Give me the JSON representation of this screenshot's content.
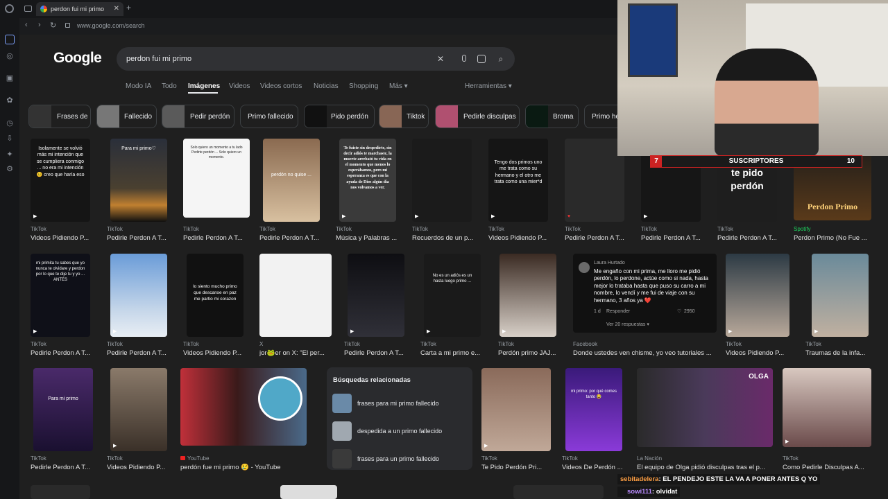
{
  "browser": {
    "tab_title": "perdon fui mi primo",
    "url": "www.google.com/search"
  },
  "google": {
    "logo": "Google",
    "query": "perdon fui mi primo",
    "nav_tabs": [
      "Modo IA",
      "Todo",
      "Imágenes",
      "Videos",
      "Videos cortos",
      "Noticias",
      "Shopping",
      "Más ▾"
    ],
    "tools": "Herramientas ▾"
  },
  "chips": [
    "Frases de",
    "Fallecido",
    "Pedir perdón",
    "Primo fallecido",
    "Pido perdón",
    "Tiktok",
    "Pedirle disculpas",
    "Broma",
    "Primo he"
  ],
  "row1": [
    {
      "src": "TikTok",
      "title": "Videos Pidiendo P...",
      "text": "Isolamente se volvió más mi intención que se cumpliera conmigo ... no era mi intención 😐 creo que haría eso"
    },
    {
      "src": "TikTok",
      "title": "Pedirle Perdon A T...",
      "text": "Para mi primo♡"
    },
    {
      "src": "TikTok",
      "title": "Pedirle Perdon A T...",
      "text": "Solo quiero un momento a tu lado Pedirte perdón ... Solo quiero un momento."
    },
    {
      "src": "TikTok",
      "title": "Pedirle Perdon A T...",
      "text": "perdón no quise ..."
    },
    {
      "src": "TikTok",
      "title": "Música y Palabras ...",
      "text": "Te fuiste sin despedirte, sin decir adiós te marchaste, la muerte arrebató tu vida en el momento que menos lo esperábamos, pero mi esperanza es que con la ayuda de Dios algún día nos volvamos a ver."
    },
    {
      "src": "TikTok",
      "title": "Recuerdos de un p...",
      "text": ""
    },
    {
      "src": "TikTok",
      "title": "Videos Pidiendo P...",
      "text": "Tengo dos primos uno me trata como su hermano y el otro me trata como una mier*d"
    },
    {
      "src": "TikTok",
      "title": "Pedirle Perdon A T...",
      "text": ""
    },
    {
      "src": "TikTok",
      "title": "Pedirle Perdon A T...",
      "text": ""
    },
    {
      "src": "TikTok",
      "title": "Pedirle Perdon A T...",
      "text": "te pido perdón"
    },
    {
      "src": "Spotify",
      "title": "Perdon Primo (No Fue ...",
      "text": "Perdon Primo"
    }
  ],
  "row2": [
    {
      "src": "TikTok",
      "title": "Pedirle Perdon A T...",
      "text": "mi primita tu sabes que yo nunca te olvidare y perdon por lo que te dije tu y yo ... ANTES"
    },
    {
      "src": "TikTok",
      "title": "Pedirle Perdon A T...",
      "text": ""
    },
    {
      "src": "TikTok",
      "title": "Videos Pidiendo P...",
      "text": "lo siento mucho primo que descanse en paz me partio mi corazon"
    },
    {
      "src": "X",
      "title": "jor🐸er on X: \"El per...",
      "text": ""
    },
    {
      "src": "TikTok",
      "title": "Pedirle Perdon A T...",
      "text": ""
    },
    {
      "src": "TikTok",
      "title": "Carta a mi primo e...",
      "text": "No es un adiós es un hasta luego primo ..."
    },
    {
      "src": "TikTok",
      "title": "Perdón primo JAJ...",
      "text": ""
    },
    {
      "src": "Facebook",
      "title": "Donde ustedes ven chisme, yo veo tutoriales ...",
      "text": ""
    },
    {
      "src": "TikTok",
      "title": "Videos Pidiendo P...",
      "text": ""
    },
    {
      "src": "TikTok",
      "title": "Traumas de la infa...",
      "text": ""
    }
  ],
  "facebook_post": {
    "author": "Laura Hurtado",
    "body": "Me engaño con mi prima, me lloro me pidió perdón, lo perdone, actúe como si nada, hasta mejor lo trataba hasta que puso su carro a mi nombre, lo vendí y me fui de viaje con su hermano, 3 años ya ❤️",
    "time": "1 d",
    "reply": "Responder",
    "likes": "2950",
    "more": "Ver 20 respuestas ▾"
  },
  "row3": [
    {
      "src": "TikTok",
      "title": "Pedirle Perdon A T...",
      "text": "Para mi primo"
    },
    {
      "src": "TikTok",
      "title": "Videos Pidiendo P...",
      "text": ""
    },
    {
      "src": "YouTube",
      "title": "perdón fue mi primo 😢 - YouTube",
      "text": ""
    },
    {
      "src": "TikTok",
      "title": "Te Pido Perdón Pri...",
      "text": ""
    },
    {
      "src": "TikTok",
      "title": "Videos De Perdón ...",
      "text": "mi primo: por qué comes tanto 😂"
    },
    {
      "src": "La Nación",
      "title": "El equipo de Olga pidió disculpas tras el p...",
      "text": "OLGA"
    },
    {
      "src": "TikTok",
      "title": "Como Pedirle Disculpas A...",
      "text": ""
    }
  ],
  "related": {
    "heading": "Búsquedas relacionadas",
    "items": [
      "frases para mi primo fallecido",
      "despedida a un primo fallecido",
      "frases para un primo fallecido"
    ]
  },
  "overlay": {
    "subs_count": "7",
    "subs_label": "SUSCRIPTORES",
    "subs_goal": "10",
    "chat": [
      {
        "user": "sebitadelera",
        "msg": ": EL PENDEJO ESTE LA VA A PONER ANTES Q YO"
      },
      {
        "user": "sowi111",
        "msg": ": olvidat"
      }
    ]
  },
  "colors": {
    "bg": "#1f1f1f",
    "chat_user": "#ff9f43",
    "chat_user2": "#b98bff",
    "subs_bar": "#cc2222"
  },
  "icons": [
    "back-icon",
    "forward-icon",
    "reload-icon",
    "lock-icon",
    "clear-icon",
    "mic-icon",
    "lens-icon",
    "search-icon",
    "play-icon"
  ]
}
